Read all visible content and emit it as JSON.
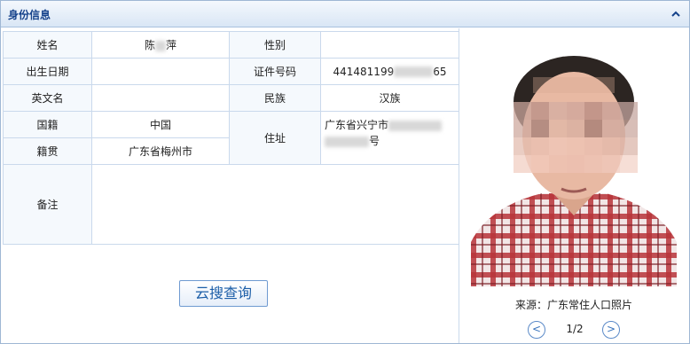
{
  "panel": {
    "title": "身份信息"
  },
  "fields": {
    "name_label": "姓名",
    "name_value": "陈",
    "name_value_tail": "萍",
    "gender_label": "性别",
    "gender_value": "",
    "birth_label": "出生日期",
    "birth_value": "",
    "id_label": "证件号码",
    "id_value_prefix": "441481199",
    "id_value_suffix": "65",
    "english_label": "英文名",
    "english_value": "",
    "ethnic_label": "民族",
    "ethnic_value": "汉族",
    "nationality_label": "国籍",
    "nationality_value": "中国",
    "address_label": "住址",
    "address_line1": "广东省兴宁市",
    "address_line2_suffix": "号",
    "native_label": "籍贯",
    "native_value": "广东省梅州市",
    "remark_label": "备注",
    "remark_value": ""
  },
  "search_button": {
    "label": "云搜查询"
  },
  "photo": {
    "source": "来源：广东常住人口照片",
    "pager": "1/2",
    "prev": "<",
    "next": ">"
  }
}
